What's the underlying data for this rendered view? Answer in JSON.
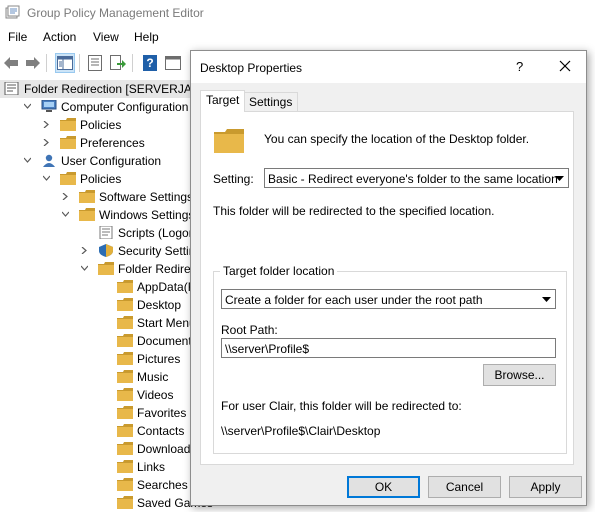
{
  "window": {
    "title": "Group Policy Management Editor"
  },
  "menu": [
    "File",
    "Action",
    "View",
    "Help"
  ],
  "toolbar": {
    "icons": [
      "back-icon",
      "forward-icon",
      "show-tree-icon",
      "properties-icon",
      "export-icon",
      "help-icon",
      "console-tree-icon"
    ]
  },
  "tree": {
    "items": [
      {
        "label": "Folder Redirection [SERVERJAEH",
        "icon": "policy-icon",
        "expander": "none"
      },
      {
        "label": "Computer Configuration",
        "icon": "computer-icon",
        "expander": "down"
      },
      {
        "label": "Policies",
        "icon": "folder-icon",
        "expander": "right"
      },
      {
        "label": "Preferences",
        "icon": "folder-icon",
        "expander": "right"
      },
      {
        "label": "User Configuration",
        "icon": "user-icon",
        "expander": "down"
      },
      {
        "label": "Policies",
        "icon": "folder-icon",
        "expander": "down"
      },
      {
        "label": "Software Settings",
        "icon": "folder-icon",
        "expander": "right"
      },
      {
        "label": "Windows Settings",
        "icon": "folder-icon",
        "expander": "down"
      },
      {
        "label": "Scripts (Logon/Lo",
        "icon": "script-icon",
        "expander": "none"
      },
      {
        "label": "Security Settings",
        "icon": "security-icon",
        "expander": "right"
      },
      {
        "label": "Folder Redirection",
        "icon": "folder-icon",
        "expander": "down"
      },
      {
        "label": "AppData(Roa",
        "icon": "folder-icon",
        "expander": "none"
      },
      {
        "label": "Desktop",
        "icon": "folder-icon",
        "expander": "none"
      },
      {
        "label": "Start Menu",
        "icon": "folder-icon",
        "expander": "none"
      },
      {
        "label": "Documents",
        "icon": "folder-icon",
        "expander": "none"
      },
      {
        "label": "Pictures",
        "icon": "folder-icon",
        "expander": "none"
      },
      {
        "label": "Music",
        "icon": "folder-icon",
        "expander": "none"
      },
      {
        "label": "Videos",
        "icon": "folder-icon",
        "expander": "none"
      },
      {
        "label": "Favorites",
        "icon": "folder-icon",
        "expander": "none"
      },
      {
        "label": "Contacts",
        "icon": "folder-icon",
        "expander": "none"
      },
      {
        "label": "Downloads",
        "icon": "folder-icon",
        "expander": "none"
      },
      {
        "label": "Links",
        "icon": "folder-icon",
        "expander": "none"
      },
      {
        "label": "Searches",
        "icon": "folder-icon",
        "expander": "none"
      },
      {
        "label": "Saved Games",
        "icon": "folder-icon",
        "expander": "none"
      }
    ]
  },
  "dialog": {
    "title": "Desktop Properties",
    "help_label": "?",
    "tabs": [
      "Target",
      "Settings"
    ],
    "intro": "You can specify the location of the Desktop folder.",
    "setting_label": "Setting:",
    "setting_value": "Basic - Redirect everyone's folder to the same location",
    "redirect_info": "This folder will be redirected to the specified location.",
    "group_title": "Target folder location",
    "location_value": "Create a folder for each user under the root path",
    "root_path_label": "Root Path:",
    "root_path_value": "\\\\server\\Profile$",
    "browse_label": "Browse...",
    "user_info": "For user Clair, this folder will be redirected to:",
    "user_path": "\\\\server\\Profile$\\Clair\\Desktop",
    "buttons": {
      "ok": "OK",
      "cancel": "Cancel",
      "apply": "Apply"
    }
  },
  "colors": {
    "folder": "#e8b84a",
    "folder_dark": "#c99a2e",
    "selected": "#cce4f7",
    "accent": "#0078d7"
  }
}
